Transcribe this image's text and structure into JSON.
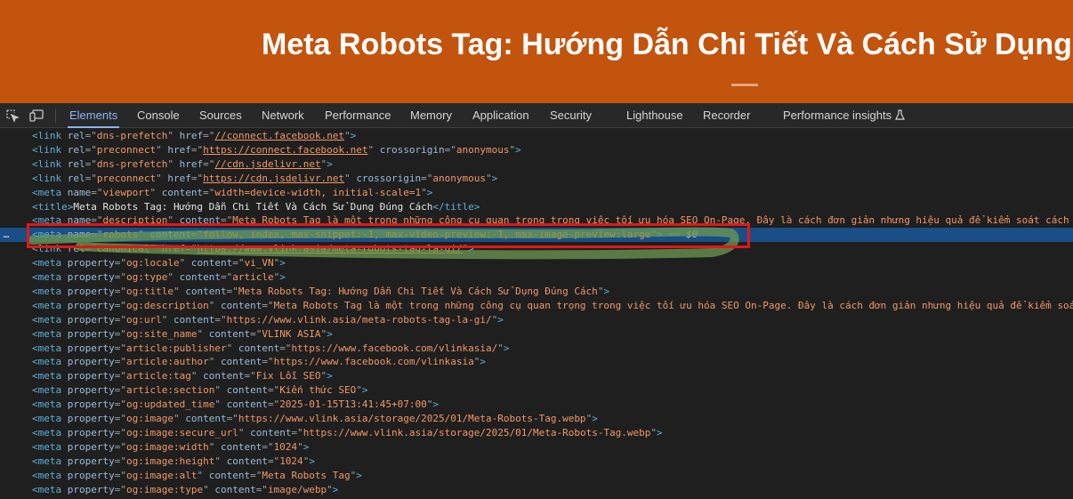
{
  "banner": {
    "title": "Meta Robots Tag: Hướng Dẫn Chi Tiết Và Cách Sử Dụng Đúng Cách"
  },
  "toolbar": {
    "icons": [
      "inspect-element-icon",
      "device-toolbar-icon",
      "flask-icon"
    ],
    "tabs": [
      "Elements",
      "Console",
      "Sources",
      "Network",
      "Performance",
      "Memory",
      "Application",
      "Security",
      "Lighthouse",
      "Recorder",
      "Performance insights"
    ],
    "active_tab": "Elements"
  },
  "elements": {
    "selected_marker": "…",
    "colors": {
      "tag": "#5db0d7",
      "attr": "#9bbbdc",
      "value": "#f29766",
      "selection": "#1a4e87",
      "highlight_box": "#e11717"
    },
    "lines": [
      [
        [
          "t",
          "<link "
        ],
        [
          "a",
          "rel"
        ],
        [
          "eq",
          "=\""
        ],
        [
          "v",
          "dns-prefetch"
        ],
        [
          "eq",
          "\" "
        ],
        [
          "a",
          "href"
        ],
        [
          "eq",
          "=\""
        ],
        [
          "u",
          "//connect.facebook.net"
        ],
        [
          "eq",
          "\""
        ],
        [
          "t",
          ">"
        ]
      ],
      [
        [
          "t",
          "<link "
        ],
        [
          "a",
          "rel"
        ],
        [
          "eq",
          "=\""
        ],
        [
          "v",
          "preconnect"
        ],
        [
          "eq",
          "\" "
        ],
        [
          "a",
          "href"
        ],
        [
          "eq",
          "=\""
        ],
        [
          "u",
          "https://connect.facebook.net"
        ],
        [
          "eq",
          "\" "
        ],
        [
          "a",
          "crossorigin"
        ],
        [
          "eq",
          "=\""
        ],
        [
          "v",
          "anonymous"
        ],
        [
          "eq",
          "\""
        ],
        [
          "t",
          ">"
        ]
      ],
      [
        [
          "t",
          "<link "
        ],
        [
          "a",
          "rel"
        ],
        [
          "eq",
          "=\""
        ],
        [
          "v",
          "dns-prefetch"
        ],
        [
          "eq",
          "\" "
        ],
        [
          "a",
          "href"
        ],
        [
          "eq",
          "=\""
        ],
        [
          "u",
          "//cdn.jsdelivr.net"
        ],
        [
          "eq",
          "\""
        ],
        [
          "t",
          ">"
        ]
      ],
      [
        [
          "t",
          "<link "
        ],
        [
          "a",
          "rel"
        ],
        [
          "eq",
          "=\""
        ],
        [
          "v",
          "preconnect"
        ],
        [
          "eq",
          "\" "
        ],
        [
          "a",
          "href"
        ],
        [
          "eq",
          "=\""
        ],
        [
          "u",
          "https://cdn.jsdelivr.net"
        ],
        [
          "eq",
          "\" "
        ],
        [
          "a",
          "crossorigin"
        ],
        [
          "eq",
          "=\""
        ],
        [
          "v",
          "anonymous"
        ],
        [
          "eq",
          "\""
        ],
        [
          "t",
          ">"
        ]
      ],
      [
        [
          "t",
          "<meta "
        ],
        [
          "a",
          "name"
        ],
        [
          "eq",
          "=\""
        ],
        [
          "v",
          "viewport"
        ],
        [
          "eq",
          "\" "
        ],
        [
          "a",
          "content"
        ],
        [
          "eq",
          "=\""
        ],
        [
          "v",
          "width=device-width, initial-scale=1"
        ],
        [
          "eq",
          "\""
        ],
        [
          "t",
          ">"
        ]
      ],
      [
        [
          "t",
          "<title>"
        ],
        [
          "tx",
          "Meta Robots Tag: Hướng Dẫn Chi Tiết Và Cách Sử Dụng Đúng Cách"
        ],
        [
          "t",
          "</title>"
        ]
      ],
      [
        [
          "t",
          "<meta "
        ],
        [
          "a",
          "name"
        ],
        [
          "eq",
          "=\""
        ],
        [
          "v",
          "description"
        ],
        [
          "eq",
          "\" "
        ],
        [
          "a",
          "content"
        ],
        [
          "eq",
          "=\""
        ],
        [
          "v",
          "Meta Robots Tag là một trong những công cụ quan trọng trong việc tối ưu hóa SEO On-Page. Đây là cách đơn giản nhưng hiệu quả để kiểm soát cách"
        ]
      ],
      [
        [
          "t",
          "<meta "
        ],
        [
          "a",
          "name"
        ],
        [
          "eq",
          "=\""
        ],
        [
          "v",
          "robots"
        ],
        [
          "eq",
          "\" "
        ],
        [
          "a",
          "content"
        ],
        [
          "eq",
          "=\""
        ],
        [
          "v",
          "follow, index, max-snippet:-1, max-video-preview:-1, max-image-preview:large"
        ],
        [
          "eq",
          "\""
        ],
        [
          "t",
          ">"
        ],
        [
          "eq",
          " == "
        ],
        [
          "dv",
          "$0"
        ]
      ],
      [
        [
          "t",
          "<link "
        ],
        [
          "a",
          "rel"
        ],
        [
          "eq",
          "=\""
        ],
        [
          "v",
          "canonical"
        ],
        [
          "eq",
          "\" "
        ],
        [
          "a",
          "href"
        ],
        [
          "eq",
          "=\""
        ],
        [
          "u",
          "https://www.vlink.asia/meta-robots-tag-la-gi/"
        ],
        [
          "eq",
          "\""
        ],
        [
          "t",
          ">"
        ]
      ],
      [
        [
          "t",
          "<meta "
        ],
        [
          "a",
          "property"
        ],
        [
          "eq",
          "=\""
        ],
        [
          "v",
          "og:locale"
        ],
        [
          "eq",
          "\" "
        ],
        [
          "a",
          "content"
        ],
        [
          "eq",
          "=\""
        ],
        [
          "v",
          "vi_VN"
        ],
        [
          "eq",
          "\""
        ],
        [
          "t",
          ">"
        ]
      ],
      [
        [
          "t",
          "<meta "
        ],
        [
          "a",
          "property"
        ],
        [
          "eq",
          "=\""
        ],
        [
          "v",
          "og:type"
        ],
        [
          "eq",
          "\" "
        ],
        [
          "a",
          "content"
        ],
        [
          "eq",
          "=\""
        ],
        [
          "v",
          "article"
        ],
        [
          "eq",
          "\""
        ],
        [
          "t",
          ">"
        ]
      ],
      [
        [
          "t",
          "<meta "
        ],
        [
          "a",
          "property"
        ],
        [
          "eq",
          "=\""
        ],
        [
          "v",
          "og:title"
        ],
        [
          "eq",
          "\" "
        ],
        [
          "a",
          "content"
        ],
        [
          "eq",
          "=\""
        ],
        [
          "v",
          "Meta Robots Tag: Hướng Dẫn Chi Tiết Và Cách Sử Dụng Đúng Cách"
        ],
        [
          "eq",
          "\""
        ],
        [
          "t",
          ">"
        ]
      ],
      [
        [
          "t",
          "<meta "
        ],
        [
          "a",
          "property"
        ],
        [
          "eq",
          "=\""
        ],
        [
          "v",
          "og:description"
        ],
        [
          "eq",
          "\" "
        ],
        [
          "a",
          "content"
        ],
        [
          "eq",
          "=\""
        ],
        [
          "v",
          "Meta Robots Tag là một trong những công cụ quan trọng trong việc tối ưu hóa SEO On-Page. Đây là cách đơn giản nhưng hiệu quả để kiểm soát"
        ]
      ],
      [
        [
          "t",
          "<meta "
        ],
        [
          "a",
          "property"
        ],
        [
          "eq",
          "=\""
        ],
        [
          "v",
          "og:url"
        ],
        [
          "eq",
          "\" "
        ],
        [
          "a",
          "content"
        ],
        [
          "eq",
          "=\""
        ],
        [
          "v",
          "https://www.vlink.asia/meta-robots-tag-la-gi/"
        ],
        [
          "eq",
          "\""
        ],
        [
          "t",
          ">"
        ]
      ],
      [
        [
          "t",
          "<meta "
        ],
        [
          "a",
          "property"
        ],
        [
          "eq",
          "=\""
        ],
        [
          "v",
          "og:site_name"
        ],
        [
          "eq",
          "\" "
        ],
        [
          "a",
          "content"
        ],
        [
          "eq",
          "=\""
        ],
        [
          "v",
          "VLINK ASIA"
        ],
        [
          "eq",
          "\""
        ],
        [
          "t",
          ">"
        ]
      ],
      [
        [
          "t",
          "<meta "
        ],
        [
          "a",
          "property"
        ],
        [
          "eq",
          "=\""
        ],
        [
          "v",
          "article:publisher"
        ],
        [
          "eq",
          "\" "
        ],
        [
          "a",
          "content"
        ],
        [
          "eq",
          "=\""
        ],
        [
          "v",
          "https://www.facebook.com/vlinkasia/"
        ],
        [
          "eq",
          "\""
        ],
        [
          "t",
          ">"
        ]
      ],
      [
        [
          "t",
          "<meta "
        ],
        [
          "a",
          "property"
        ],
        [
          "eq",
          "=\""
        ],
        [
          "v",
          "article:author"
        ],
        [
          "eq",
          "\" "
        ],
        [
          "a",
          "content"
        ],
        [
          "eq",
          "=\""
        ],
        [
          "v",
          "https://www.facebook.com/vlinkasia"
        ],
        [
          "eq",
          "\""
        ],
        [
          "t",
          ">"
        ]
      ],
      [
        [
          "t",
          "<meta "
        ],
        [
          "a",
          "property"
        ],
        [
          "eq",
          "=\""
        ],
        [
          "v",
          "article:tag"
        ],
        [
          "eq",
          "\" "
        ],
        [
          "a",
          "content"
        ],
        [
          "eq",
          "=\""
        ],
        [
          "v",
          "Fix Lỗi SEO"
        ],
        [
          "eq",
          "\""
        ],
        [
          "t",
          ">"
        ]
      ],
      [
        [
          "t",
          "<meta "
        ],
        [
          "a",
          "property"
        ],
        [
          "eq",
          "=\""
        ],
        [
          "v",
          "article:section"
        ],
        [
          "eq",
          "\" "
        ],
        [
          "a",
          "content"
        ],
        [
          "eq",
          "=\""
        ],
        [
          "v",
          "Kiến thức SEO"
        ],
        [
          "eq",
          "\""
        ],
        [
          "t",
          ">"
        ]
      ],
      [
        [
          "t",
          "<meta "
        ],
        [
          "a",
          "property"
        ],
        [
          "eq",
          "=\""
        ],
        [
          "v",
          "og:updated_time"
        ],
        [
          "eq",
          "\" "
        ],
        [
          "a",
          "content"
        ],
        [
          "eq",
          "=\""
        ],
        [
          "v",
          "2025-01-15T13:41:45+07:00"
        ],
        [
          "eq",
          "\""
        ],
        [
          "t",
          ">"
        ]
      ],
      [
        [
          "t",
          "<meta "
        ],
        [
          "a",
          "property"
        ],
        [
          "eq",
          "=\""
        ],
        [
          "v",
          "og:image"
        ],
        [
          "eq",
          "\" "
        ],
        [
          "a",
          "content"
        ],
        [
          "eq",
          "=\""
        ],
        [
          "v",
          "https://www.vlink.asia/storage/2025/01/Meta-Robots-Tag.webp"
        ],
        [
          "eq",
          "\""
        ],
        [
          "t",
          ">"
        ]
      ],
      [
        [
          "t",
          "<meta "
        ],
        [
          "a",
          "property"
        ],
        [
          "eq",
          "=\""
        ],
        [
          "v",
          "og:image:secure_url"
        ],
        [
          "eq",
          "\" "
        ],
        [
          "a",
          "content"
        ],
        [
          "eq",
          "=\""
        ],
        [
          "v",
          "https://www.vlink.asia/storage/2025/01/Meta-Robots-Tag.webp"
        ],
        [
          "eq",
          "\""
        ],
        [
          "t",
          ">"
        ]
      ],
      [
        [
          "t",
          "<meta "
        ],
        [
          "a",
          "property"
        ],
        [
          "eq",
          "=\""
        ],
        [
          "v",
          "og:image:width"
        ],
        [
          "eq",
          "\" "
        ],
        [
          "a",
          "content"
        ],
        [
          "eq",
          "=\""
        ],
        [
          "v",
          "1024"
        ],
        [
          "eq",
          "\""
        ],
        [
          "t",
          ">"
        ]
      ],
      [
        [
          "t",
          "<meta "
        ],
        [
          "a",
          "property"
        ],
        [
          "eq",
          "=\""
        ],
        [
          "v",
          "og:image:height"
        ],
        [
          "eq",
          "\" "
        ],
        [
          "a",
          "content"
        ],
        [
          "eq",
          "=\""
        ],
        [
          "v",
          "1024"
        ],
        [
          "eq",
          "\""
        ],
        [
          "t",
          ">"
        ]
      ],
      [
        [
          "t",
          "<meta "
        ],
        [
          "a",
          "property"
        ],
        [
          "eq",
          "=\""
        ],
        [
          "v",
          "og:image:alt"
        ],
        [
          "eq",
          "\" "
        ],
        [
          "a",
          "content"
        ],
        [
          "eq",
          "=\""
        ],
        [
          "v",
          "Meta Robots Tag"
        ],
        [
          "eq",
          "\""
        ],
        [
          "t",
          ">"
        ]
      ],
      [
        [
          "t",
          "<meta "
        ],
        [
          "a",
          "property"
        ],
        [
          "eq",
          "=\""
        ],
        [
          "v",
          "og:image:type"
        ],
        [
          "eq",
          "\" "
        ],
        [
          "a",
          "content"
        ],
        [
          "eq",
          "=\""
        ],
        [
          "v",
          "image/webp"
        ],
        [
          "eq",
          "\""
        ],
        [
          "t",
          ">"
        ]
      ]
    ]
  }
}
